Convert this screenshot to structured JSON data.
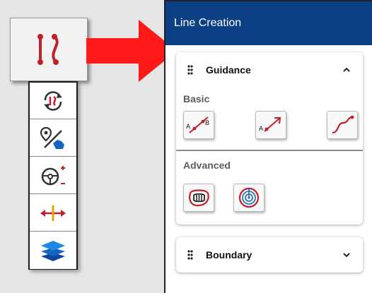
{
  "panel": {
    "title": "Line Creation"
  },
  "guidance": {
    "title": "Guidance",
    "basic_label": "Basic",
    "advanced_label": "Advanced",
    "ab_labels": {
      "a": "A",
      "b": "B"
    },
    "heading_label": "A"
  },
  "boundary": {
    "title": "Boundary"
  },
  "icons": {
    "main_tool": "line-creation-icon",
    "toolbar": [
      "sync-icon",
      "location-field-icon",
      "steering-offset-icon",
      "width-adjust-icon",
      "layers-icon"
    ],
    "guidance_basic": [
      "ab-line-icon",
      "a-plus-heading-icon",
      "curve-line-icon"
    ],
    "guidance_advanced": [
      "headland-icon",
      "pivot-icon"
    ]
  },
  "colors": {
    "header_bg": "#0d3f84",
    "accent_red": "#c0202a",
    "arrow_red": "#ff1a1a",
    "layers_blue": "#1565c0"
  }
}
